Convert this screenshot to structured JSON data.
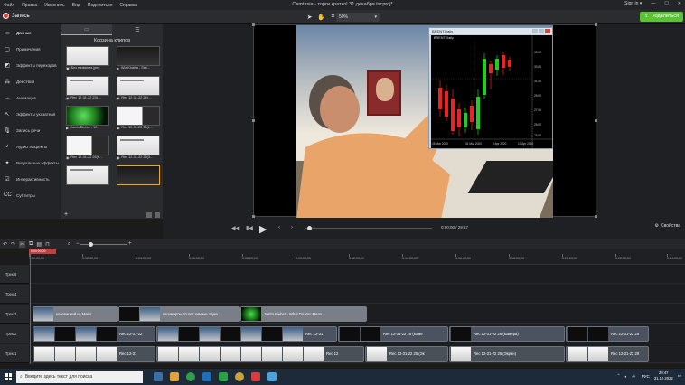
{
  "menubar": {
    "items": [
      "Файл",
      "Правка",
      "Изменить",
      "Вид",
      "Поделиться",
      "Справка"
    ],
    "window_title": "Camtasia - торги кратко! 31 декабря.tscproj*",
    "sign_in": "Sign in ▾"
  },
  "toolbar": {
    "record_label": "Запись",
    "zoom_value": "50%",
    "share_label": "Поделиться"
  },
  "sidebar": {
    "items": [
      {
        "label": "Данные",
        "icon": "media-icon"
      },
      {
        "label": "Примечания",
        "icon": "annotations-icon"
      },
      {
        "label": "Эффекты переходов",
        "icon": "transitions-icon"
      },
      {
        "label": "Действия",
        "icon": "behaviors-icon"
      },
      {
        "label": "Анимация",
        "icon": "animations-icon"
      },
      {
        "label": "Эффекты указателя",
        "icon": "cursor-effects-icon"
      },
      {
        "label": "Запись речи",
        "icon": "voice-narration-icon"
      },
      {
        "label": "Аудио эффекты",
        "icon": "audio-effects-icon"
      },
      {
        "label": "Визуальные эффекты",
        "icon": "visual-effects-icon"
      },
      {
        "label": "Интерактивность",
        "icon": "interactivity-icon"
      },
      {
        "label": "Субтитры",
        "icon": "captions-icon"
      }
    ]
  },
  "media_bin": {
    "title": "Корзина клипов",
    "items": [
      {
        "label": "Без названия.jpeg",
        "style": "white"
      },
      {
        "label": "Wiz Khalifa - See...",
        "style": "dark"
      },
      {
        "label": "Rec 12-31-22 23L...",
        "style": "white"
      },
      {
        "label": "Rec 12-31-22 24L...",
        "style": "white"
      },
      {
        "label": "Justin Bieber - W...",
        "style": "green"
      },
      {
        "label": "Rec 12-31-22 25(L...",
        "style": "mixed"
      },
      {
        "label": "Rec 12-31-22 26(K...",
        "style": "mixed"
      },
      {
        "label": "Rec 12-31-22 26(3...",
        "style": "white"
      },
      {
        "label": "",
        "style": "white"
      },
      {
        "label": "",
        "style": "dark"
      }
    ]
  },
  "preview": {
    "chart_window_title": "BRENT,Daily",
    "chart_symbol": "BRENT,Daily",
    "chart_dates": [
      "25 Mar 2020",
      "31 Mar 2020",
      "6 Apr 2020",
      "13 Apr 2020"
    ],
    "chart_prices": [
      "35.00",
      "33.00",
      "31.00",
      "29.00",
      "27.00",
      "25.00",
      "23.00"
    ]
  },
  "player": {
    "timecode": "0:00:00 / 29:17",
    "properties_label": "Свойства"
  },
  "timeline": {
    "playhead_time": "0:00:00;00",
    "ruler_ticks": [
      "0:00:00;00",
      "0:02:00;00",
      "0:04:00;00",
      "0:06:00;00",
      "0:08:00;00",
      "0:10:00;00",
      "0:12:00;00",
      "0:14:00;00",
      "0:16:00;00",
      "0:18:00;00",
      "0:20:00;00",
      "0:22:00;00",
      "0:24:00;00"
    ],
    "tracks": [
      {
        "label": "Трек 6"
      },
      {
        "label": "Трек 4"
      },
      {
        "label": "Трек 3"
      },
      {
        "label": "Трек 2"
      },
      {
        "label": "Трек 1"
      }
    ],
    "track3_clips": [
      "косевицкий из Майл",
      "касимирон 10 лет химиче одиш",
      "Justin Bieber - What Do You Mean"
    ],
    "track2_clips": [
      "Rec 12-31-22",
      "Rec 12-31",
      "Rec 12-31-22 25 (Каме",
      "Rec 12-31-22 26 (Камера)",
      "Rec 12-31-22 29"
    ],
    "track1_clips": [
      "Rec 12-31",
      "Rec 12",
      "Rec 12-31-22 25 (Эк",
      "Rec 12-31-22 26 (Экран)",
      "Rec 12-31-22 29"
    ]
  },
  "taskbar": {
    "search_placeholder": "Введите здесь текст для поиска",
    "lang": "РУС",
    "time": "20:47",
    "date": "31.12.2022"
  },
  "colors": {
    "accent_green": "#5bc236",
    "record_red": "#e23b3b",
    "playhead": "#c14040",
    "selection_orange": "#f2a623"
  }
}
